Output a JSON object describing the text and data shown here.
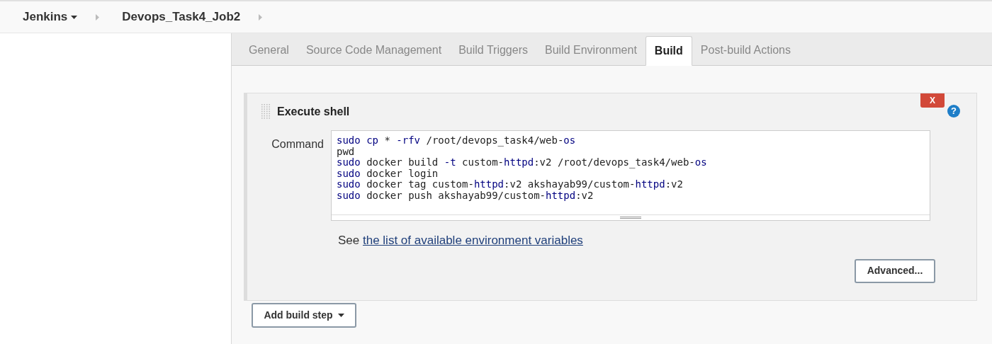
{
  "breadcrumbs": [
    {
      "label": "Jenkins",
      "dropdown": true
    },
    {
      "label": "Devops_Task4_Job2",
      "dropdown": false
    }
  ],
  "tabs": [
    {
      "label": "General",
      "selected": false
    },
    {
      "label": "Source Code Management",
      "selected": false
    },
    {
      "label": "Build Triggers",
      "selected": false
    },
    {
      "label": "Build Environment",
      "selected": false
    },
    {
      "label": "Build",
      "selected": true
    },
    {
      "label": "Post-build Actions",
      "selected": false
    }
  ],
  "build_step": {
    "title": "Execute shell",
    "delete_label": "X",
    "help_label": "?",
    "command_label": "Command",
    "command_lines": [
      [
        {
          "text": "sudo cp",
          "kind": "keyword"
        },
        {
          "text": " * ",
          "kind": "plain"
        },
        {
          "text": "-rfv",
          "kind": "keyword"
        },
        {
          "text": " /root/devops_task4/web-",
          "kind": "plain"
        },
        {
          "text": "os",
          "kind": "keyword"
        }
      ],
      [
        {
          "text": "pwd",
          "kind": "plain"
        }
      ],
      [
        {
          "text": "sudo",
          "kind": "keyword"
        },
        {
          "text": " docker build ",
          "kind": "plain"
        },
        {
          "text": "-t",
          "kind": "keyword"
        },
        {
          "text": " custom-",
          "kind": "plain"
        },
        {
          "text": "httpd",
          "kind": "keyword"
        },
        {
          "text": ":v2 /root/devops_task4/web-",
          "kind": "plain"
        },
        {
          "text": "os",
          "kind": "keyword"
        }
      ],
      [
        {
          "text": "sudo",
          "kind": "keyword"
        },
        {
          "text": " docker login",
          "kind": "plain"
        }
      ],
      [
        {
          "text": "sudo",
          "kind": "keyword"
        },
        {
          "text": " docker tag custom-",
          "kind": "plain"
        },
        {
          "text": "httpd",
          "kind": "keyword"
        },
        {
          "text": ":v2 akshayab99/custom-",
          "kind": "plain"
        },
        {
          "text": "httpd",
          "kind": "keyword"
        },
        {
          "text": ":v2",
          "kind": "plain"
        }
      ],
      [
        {
          "text": "sudo",
          "kind": "keyword"
        },
        {
          "text": " docker push akshayab99/custom-",
          "kind": "plain"
        },
        {
          "text": "httpd",
          "kind": "keyword"
        },
        {
          "text": ":v2",
          "kind": "plain"
        }
      ]
    ],
    "hint_prefix": "See",
    "hint_link": "the list of available environment variables",
    "advanced_button": "Advanced..."
  },
  "add_step_button": "Add build step"
}
